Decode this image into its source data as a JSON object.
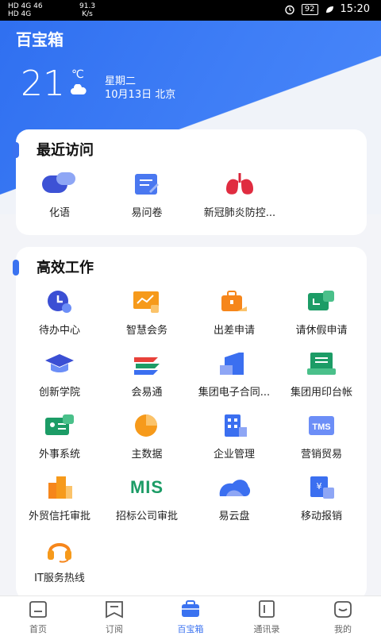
{
  "status_bar": {
    "left_line1": "HD 4G 46",
    "left_line2": "HD 4G",
    "net_speed_value": "91.3",
    "net_speed_unit": "K/s",
    "battery": "92",
    "time": "15:20"
  },
  "app": {
    "title": "百宝箱"
  },
  "weather": {
    "temperature": "21",
    "unit": "℃",
    "weekday": "星期二",
    "date_city": "10月13日 北京"
  },
  "recent": {
    "title": "最近访问",
    "items": [
      {
        "label": "化语",
        "icon": "chat-bubble-icon"
      },
      {
        "label": "易问卷",
        "icon": "questionnaire-icon"
      },
      {
        "label": "新冠肺炎防控...",
        "icon": "lungs-icon"
      }
    ]
  },
  "work": {
    "title": "高效工作",
    "items": [
      {
        "label": "待办中心",
        "icon": "clock-icon"
      },
      {
        "label": "智慧会务",
        "icon": "presentation-icon"
      },
      {
        "label": "出差申请",
        "icon": "briefcase-icon"
      },
      {
        "label": "请休假申请",
        "icon": "leave-icon"
      },
      {
        "label": "创新学院",
        "icon": "graduation-cap-icon"
      },
      {
        "label": "会易通",
        "icon": "layers-icon"
      },
      {
        "label": "集团电子合同...",
        "icon": "contract-icon"
      },
      {
        "label": "集团用印台帐",
        "icon": "seal-ledger-icon"
      },
      {
        "label": "外事系统",
        "icon": "id-card-icon"
      },
      {
        "label": "主数据",
        "icon": "pie-chart-icon"
      },
      {
        "label": "企业管理",
        "icon": "building-icon"
      },
      {
        "label": "营销贸易",
        "icon": "tms-icon"
      },
      {
        "label": "外贸信托审批",
        "icon": "bar-building-icon"
      },
      {
        "label": "招标公司审批",
        "icon": "mis-logo-icon"
      },
      {
        "label": "易云盘",
        "icon": "cloud-icon"
      },
      {
        "label": "移动报销",
        "icon": "reimbursement-icon"
      },
      {
        "label": "IT服务热线",
        "icon": "headset-icon"
      }
    ]
  },
  "mis_text": "MIS",
  "tms_text": "TMS",
  "nav": [
    {
      "label": "首页",
      "icon": "home-icon"
    },
    {
      "label": "订阅",
      "icon": "subscribe-icon"
    },
    {
      "label": "百宝箱",
      "icon": "toolbox-icon"
    },
    {
      "label": "通讯录",
      "icon": "contacts-icon"
    },
    {
      "label": "我的",
      "icon": "profile-icon"
    }
  ],
  "colors": {
    "primary": "#3a72f0",
    "header": "#3f7ef6"
  }
}
